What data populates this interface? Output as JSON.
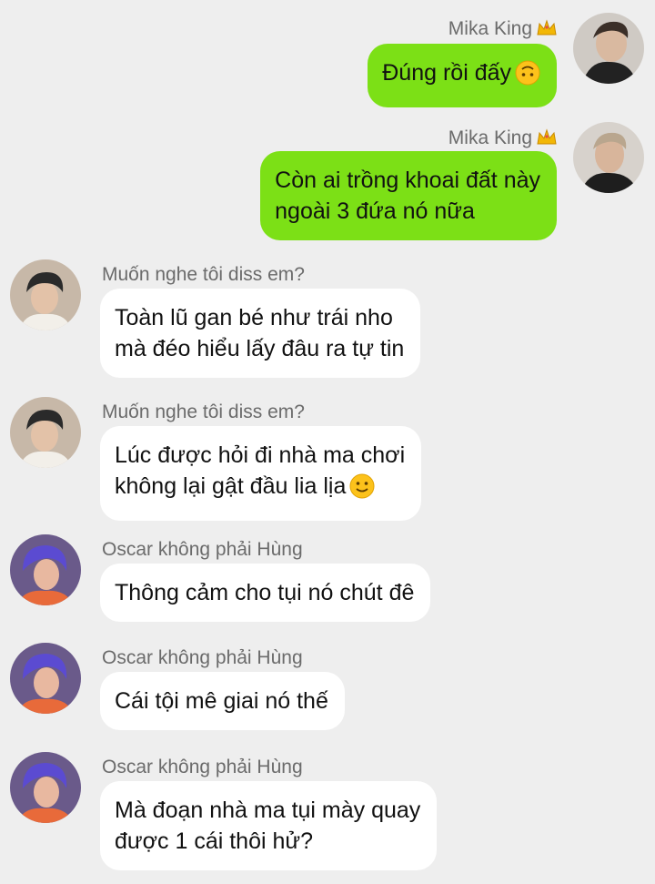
{
  "messages": [
    {
      "sender": "Mika King",
      "direction": "out",
      "lines": [
        "Đúng rồi đấy"
      ],
      "emoji": "upside-down-face"
    },
    {
      "sender": "Mika King",
      "direction": "out",
      "lines": [
        "Còn ai trồng khoai đất này",
        "ngoài 3 đứa nó nữa"
      ]
    },
    {
      "sender": "Muốn nghe tôi diss em?",
      "direction": "in",
      "lines": [
        "Toàn lũ gan bé như trái nho",
        "mà đéo hiểu lấy đâu ra tự tin"
      ]
    },
    {
      "sender": "Muốn nghe tôi diss em?",
      "direction": "in",
      "lines": [
        "Lúc được hỏi đi nhà ma chơi",
        "không lại gật đầu lia lịa"
      ],
      "emoji": "slightly-smiling-face"
    },
    {
      "sender": "Oscar không phải Hùng",
      "direction": "in",
      "lines": [
        "Thông cảm cho tụi nó chút đê"
      ]
    },
    {
      "sender": "Oscar không phải Hùng",
      "direction": "in",
      "lines": [
        "Cái tội mê giai nó thế"
      ]
    },
    {
      "sender": "Oscar không phải Hùng",
      "direction": "in",
      "lines": [
        "Mà đoạn nhà ma tụi mày quay",
        "được 1 cái thôi hử?"
      ]
    }
  ],
  "colors": {
    "outgoing_bubble": "#7ce016",
    "incoming_bubble": "#ffffff",
    "background": "#eeeeee",
    "name_text": "#6b6b6b"
  }
}
